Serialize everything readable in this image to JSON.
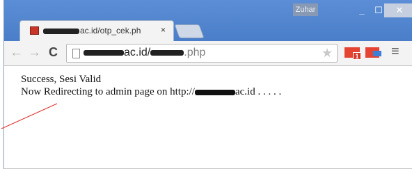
{
  "window": {
    "profile_name": "Zuhar",
    "minimize_glyph": "_",
    "maximize_glyph": "☐",
    "close_glyph": "✕"
  },
  "tab": {
    "title_suffix": "ac.id/otp_cek.ph",
    "close_glyph": "×",
    "favicon": "site-favicon"
  },
  "toolbar": {
    "back_glyph": "←",
    "forward_glyph": "→",
    "reload_glyph": "C",
    "url_mid": "ac.id/",
    "url_ext": ".php",
    "star_glyph": "★",
    "gmail_badge": "1",
    "menu_glyph": "≡"
  },
  "content": {
    "line1": "Success, Sesi Valid",
    "line2_prefix": "Now Redirecting to admin page on http://",
    "line2_suffix": "ac.id . . . . ."
  },
  "colors": {
    "titlebar": "#4a7ec8",
    "annotation_line": "#e0302a"
  }
}
